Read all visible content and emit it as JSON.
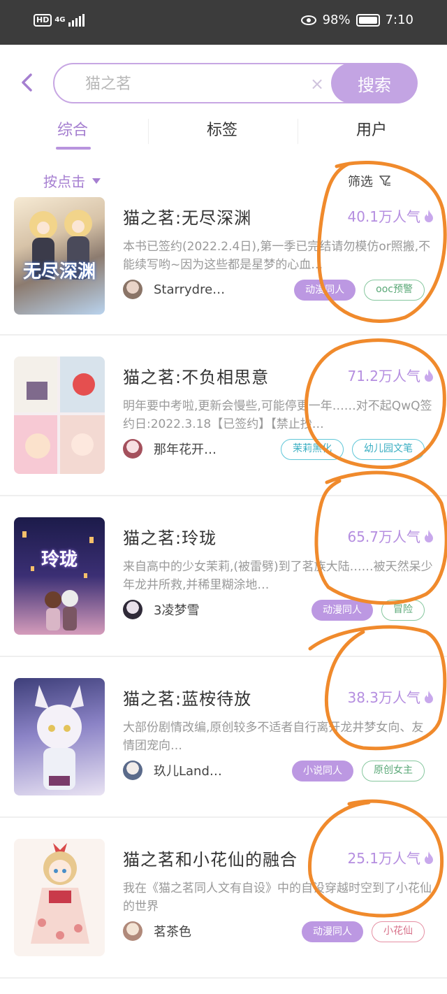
{
  "status_bar": {
    "hd": "HD",
    "network": "4G",
    "battery": "98%",
    "time": "7:10"
  },
  "search": {
    "placeholder": "猫之茗",
    "button_label": "搜索",
    "clear": "×"
  },
  "tabs": [
    {
      "label": "综合"
    },
    {
      "label": "标签"
    },
    {
      "label": "用户"
    }
  ],
  "sort_label": "按点击",
  "filter_label": "筛选",
  "books": [
    {
      "title": "猫之茗:无尽深渊",
      "popularity": "40.1万人气",
      "description": "本书已签约(2022.2.4日),第一季已完结请勿模仿or照搬,不能续写哟~因为这些都是星梦的心血…",
      "author": "Starrydre…",
      "tags": [
        "动漫同人",
        "ooc预警"
      ],
      "cover_text": "无尽深渊"
    },
    {
      "title": "猫之茗:不负相思意",
      "popularity": "71.2万人气",
      "description": "明年要中考啦,更新会慢些,可能停更一年……对不起QwQ签约日:2022.3.18【已签约】【禁止抄…",
      "author": "那年花开…",
      "tags": [
        "茉莉黑化",
        "幼儿园文笔"
      ],
      "cover_text": ""
    },
    {
      "title": "猫之茗:玲珑",
      "popularity": "65.7万人气",
      "description": "来自高中的少女茉莉,(被雷劈)到了茗族大陆……被天然呆少年龙井所救,并稀里糊涂地…",
      "author": "3凌梦雪",
      "tags": [
        "动漫同人",
        "冒险"
      ],
      "cover_text": "玲珑"
    },
    {
      "title": "猫之茗:蓝桉待放",
      "popularity": "38.3万人气",
      "description": "大部份剧情改编,原创较多不适者自行离开龙井梦女向、友情团宠向…",
      "author": "玖儿Land…",
      "tags": [
        "小说同人",
        "原创女主"
      ],
      "cover_text": ""
    },
    {
      "title": "猫之茗和小花仙的融合",
      "popularity": "25.1万人气",
      "description": "我在《猫之茗同人文有自设》中的自设穿越时空到了小花仙的世界",
      "author": "茗茶色",
      "tags": [
        "动漫同人",
        "小花仙"
      ],
      "cover_text": ""
    }
  ],
  "colors": {
    "accent": "#b58ee0",
    "annotation": "#f08a2c"
  }
}
